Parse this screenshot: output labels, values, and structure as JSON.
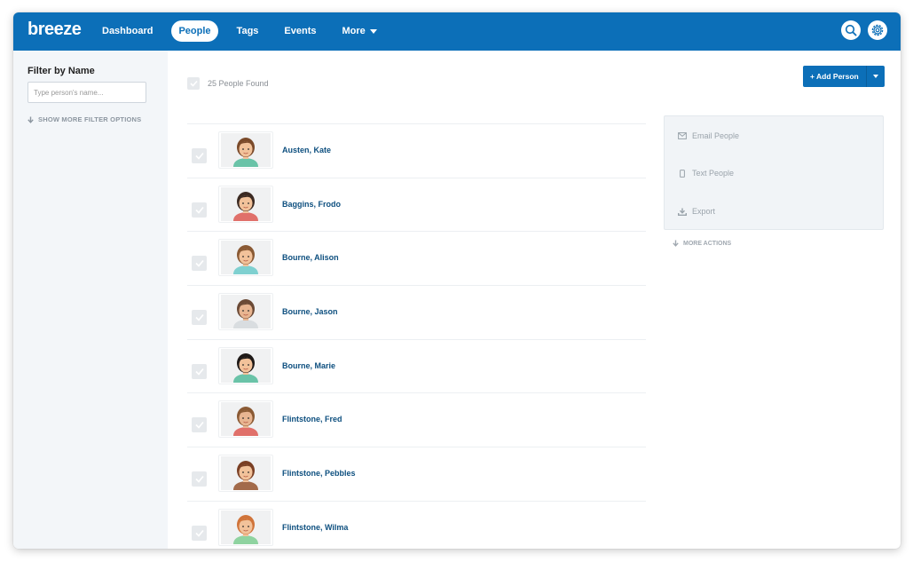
{
  "app": {
    "logo": "breeze"
  },
  "nav": {
    "items": [
      {
        "label": "Dashboard",
        "active": false
      },
      {
        "label": "People",
        "active": true
      },
      {
        "label": "Tags",
        "active": false
      },
      {
        "label": "Events",
        "active": false
      },
      {
        "label": "More",
        "active": false
      }
    ],
    "icons": [
      "search-icon",
      "gear-icon"
    ]
  },
  "sidebar": {
    "filter_title": "Filter by Name",
    "filter_placeholder": "Type person's name...",
    "more_filters": "SHOW MORE FILTER OPTIONS"
  },
  "main": {
    "people_found": "25 People Found",
    "add_person_label": "+ Add Person",
    "people": [
      {
        "name": "Austen, Kate",
        "hair": "#7a4a2a",
        "shirt": "#6ac3a8",
        "skin": "#f2c29a"
      },
      {
        "name": "Baggins, Frodo",
        "hair": "#3b2a22",
        "shirt": "#e0706a",
        "skin": "#f2c29a"
      },
      {
        "name": "Bourne, Alison",
        "hair": "#8a5a34",
        "shirt": "#7fd0d0",
        "skin": "#f2c29a"
      },
      {
        "name": "Bourne, Jason",
        "hair": "#6b4a36",
        "shirt": "#d9dde0",
        "skin": "#e8b591"
      },
      {
        "name": "Bourne, Marie",
        "hair": "#1f1a18",
        "shirt": "#6ac3a8",
        "skin": "#f2c29a"
      },
      {
        "name": "Flintstone, Fred",
        "hair": "#8a5a34",
        "shirt": "#e0706a",
        "skin": "#e8b591"
      },
      {
        "name": "Flintstone, Pebbles",
        "hair": "#7a3f24",
        "shirt": "#a26a4a",
        "skin": "#f2c29a"
      },
      {
        "name": "Flintstone, Wilma",
        "hair": "#d0743a",
        "shirt": "#8fd3a0",
        "skin": "#f2c29a"
      }
    ]
  },
  "actions": {
    "email": "Email People",
    "text": "Text People",
    "export": "Export",
    "more": "MORE ACTIONS"
  },
  "colors": {
    "brand": "#0c6fb8",
    "link": "#0d4f7f"
  }
}
